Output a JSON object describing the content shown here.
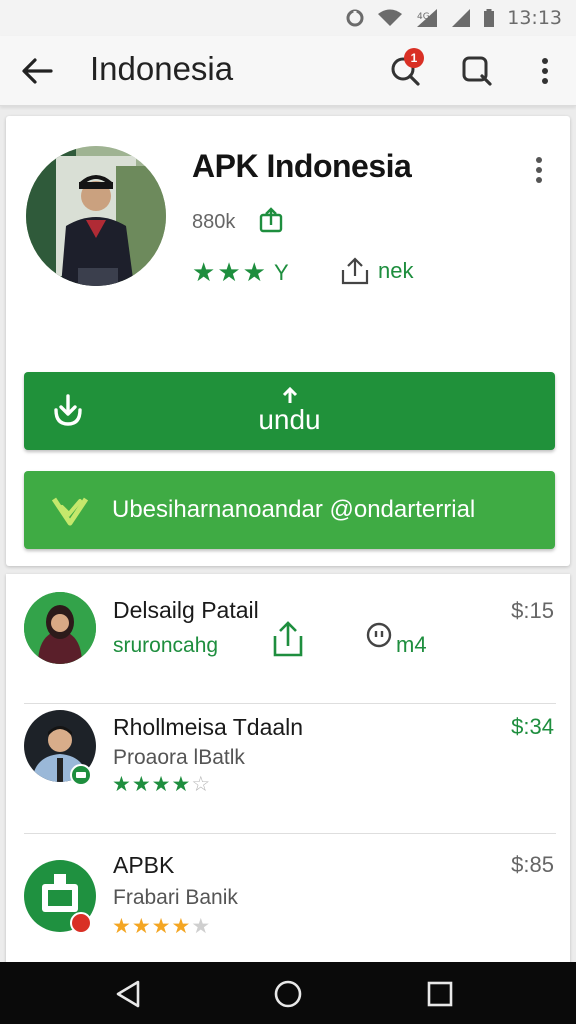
{
  "status_bar": {
    "time": "13:13"
  },
  "toolbar": {
    "title": "Indonesia",
    "notification_count": "1"
  },
  "app": {
    "name": "APK Indonesia",
    "size": "880k",
    "rating_suffix": "Y",
    "share_label": "nek",
    "download_label": "undu",
    "secondary_label": "Ubesiharnanoandar @ondarterrial",
    "rating_stars": 3
  },
  "list": [
    {
      "title": "Delsailg Patail",
      "subtitle": "sruroncahg",
      "extra": "m4",
      "price": "$:15"
    },
    {
      "title": "Rhollmeisa Tdaaln",
      "subtitle": "Proaora lBatlk",
      "price": "$:34",
      "rating_stars": 4,
      "star_color": "green"
    },
    {
      "title": "APBK",
      "subtitle": "Frabari Banik",
      "price": "$:85",
      "rating_stars": 4,
      "star_color": "gold"
    }
  ],
  "colors": {
    "accent_green": "#1e8e3e",
    "download_button": "#20913a",
    "secondary_button": "#3fab44",
    "badge_red": "#d93025",
    "star_gold": "#f4a623"
  },
  "icons": {
    "back": "arrow-left-icon",
    "notifications": "notification-search-icon",
    "search": "search-icon",
    "more": "more-vertical-icon",
    "share": "share-icon",
    "download": "download-icon",
    "verified": "verified-check-icon"
  }
}
